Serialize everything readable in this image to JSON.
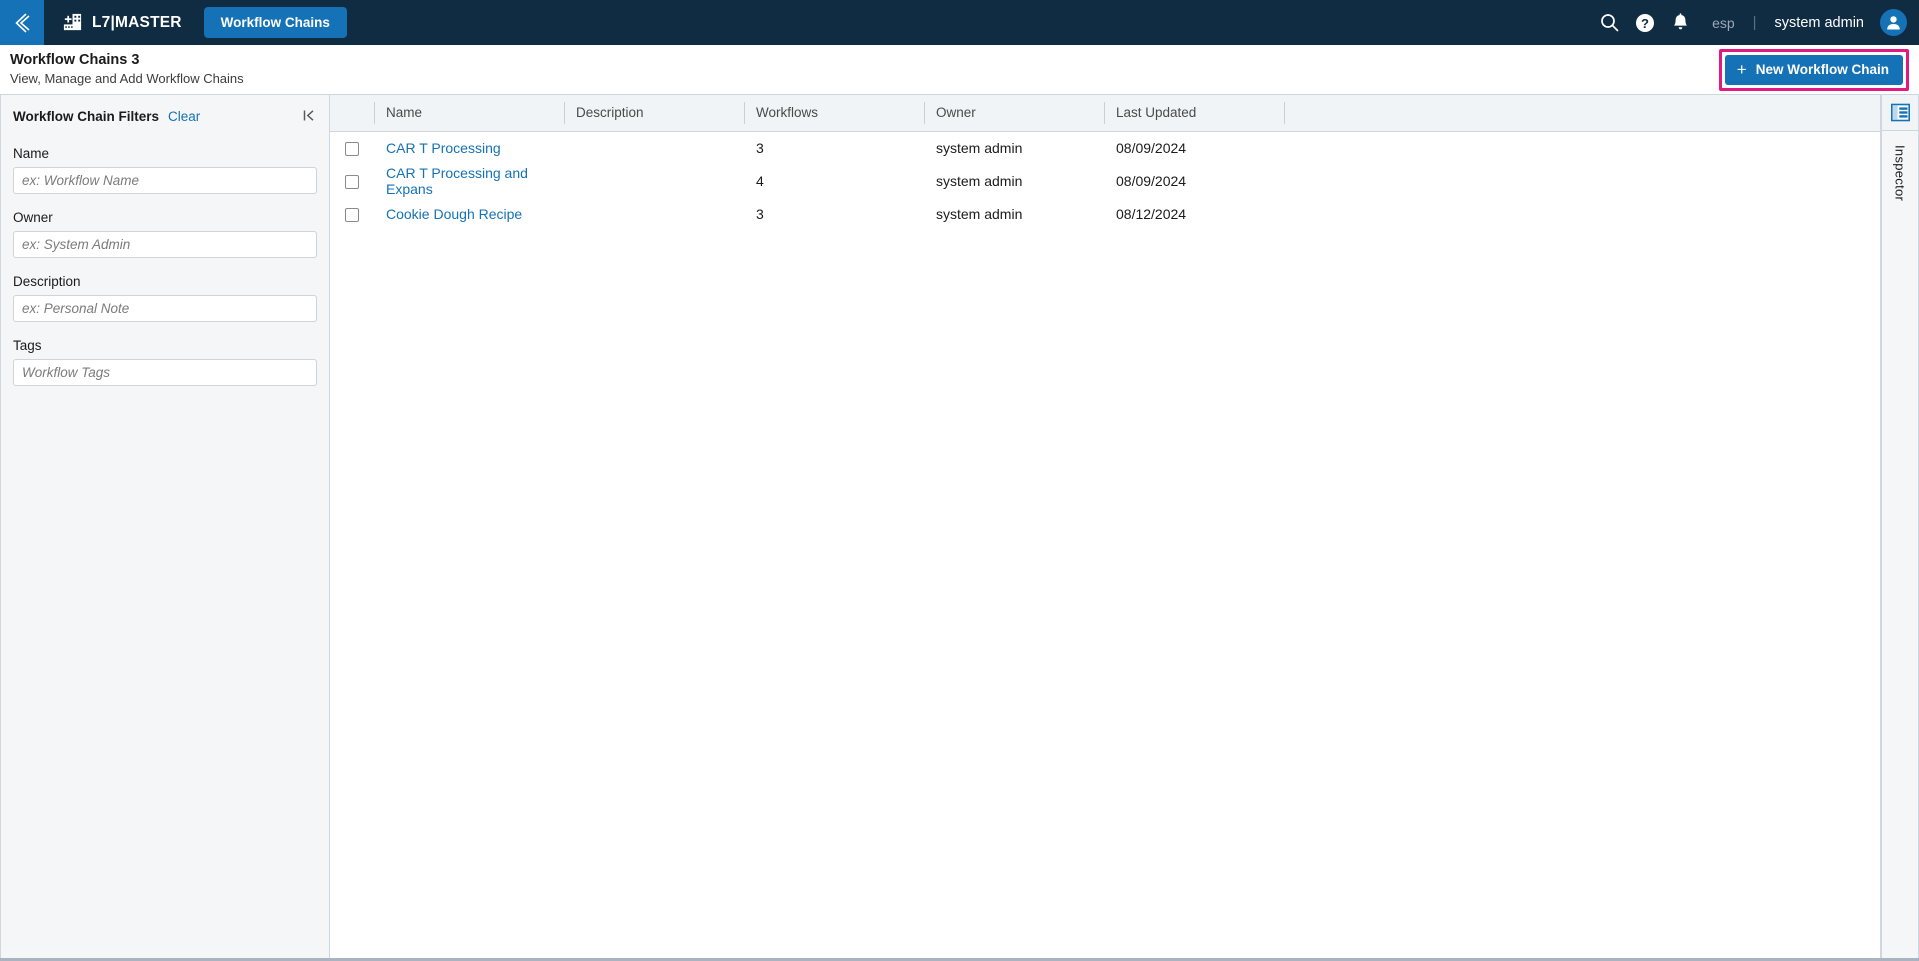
{
  "topnav": {
    "back_icon": "chevron-left-icon",
    "logo_icon": "factory-plus-logo-icon",
    "brand": "L7|MASTER",
    "active_tab": "Workflow Chains",
    "search_icon": "search-icon",
    "help_icon": "help-circle-icon",
    "notifications_icon": "bell-icon",
    "language": "esp",
    "separator": "|",
    "username": "system admin",
    "avatar_icon": "user-avatar-icon",
    "bg_color": "#0f2c43",
    "accent_color": "#1572b6"
  },
  "pagehead": {
    "title": "Workflow Chains 3",
    "subtitle": "View, Manage and Add Workflow Chains",
    "new_button_label": "New Workflow Chain",
    "new_button_plus": "+",
    "highlight_color": "#e2197e"
  },
  "sidebar": {
    "title": "Workflow Chain Filters",
    "clear_label": "Clear",
    "collapse_icon": "collapse-panel-left-icon",
    "fields": [
      {
        "label": "Name",
        "placeholder": "ex: Workflow Name",
        "value": ""
      },
      {
        "label": "Owner",
        "placeholder": "ex: System Admin",
        "value": ""
      },
      {
        "label": "Description",
        "placeholder": "ex: Personal Note",
        "value": ""
      },
      {
        "label": "Tags",
        "placeholder": "Workflow Tags",
        "value": ""
      }
    ]
  },
  "table": {
    "columns": [
      "",
      "Name",
      "Description",
      "Workflows",
      "Owner",
      "Last Updated",
      ""
    ],
    "rows": [
      {
        "name": "CAR T Processing",
        "description": "",
        "workflows": "3",
        "owner": "system admin",
        "last_updated": "08/09/2024"
      },
      {
        "name": "CAR T Processing and Expans",
        "description": "",
        "workflows": "4",
        "owner": "system admin",
        "last_updated": "08/09/2024"
      },
      {
        "name": "Cookie Dough Recipe",
        "description": "",
        "workflows": "3",
        "owner": "system admin",
        "last_updated": "08/12/2024"
      }
    ]
  },
  "inspector": {
    "icon": "inspector-panel-icon",
    "label": "Inspector"
  }
}
